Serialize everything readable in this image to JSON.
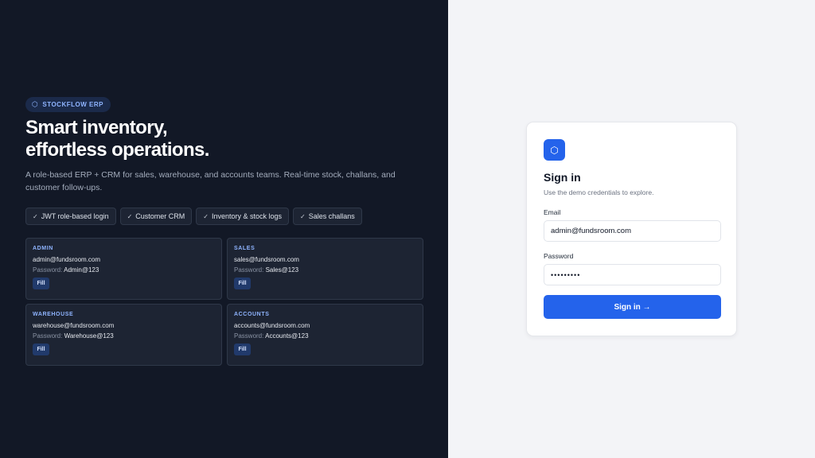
{
  "brand": {
    "icon": "hexagon-icon",
    "label": "STOCKFLOW ERP"
  },
  "hero": {
    "headline_line1": "Smart inventory,",
    "headline_line2": "effortless operations.",
    "description": "A role-based ERP + CRM for sales, warehouse, and accounts teams. Real-time stock, challans, and customer follow-ups."
  },
  "features": [
    {
      "icon": "check-icon",
      "label": "JWT role-based login"
    },
    {
      "icon": "check-icon",
      "label": "Customer CRM"
    },
    {
      "icon": "check-icon",
      "label": "Inventory & stock logs"
    },
    {
      "icon": "check-icon",
      "label": "Sales challans"
    }
  ],
  "password_label": "Password:",
  "fill_label": "Fill",
  "demo_accounts": [
    {
      "role": "ADMIN",
      "email": "admin@fundsroom.com",
      "password": "Admin@123"
    },
    {
      "role": "SALES",
      "email": "sales@fundsroom.com",
      "password": "Sales@123"
    },
    {
      "role": "WAREHOUSE",
      "email": "warehouse@fundsroom.com",
      "password": "Warehouse@123"
    },
    {
      "role": "ACCOUNTS",
      "email": "accounts@fundsroom.com",
      "password": "Accounts@123"
    }
  ],
  "login": {
    "logo_icon": "hexagon-icon",
    "title": "Sign in",
    "subtitle": "Use the demo credentials to explore.",
    "email_label": "Email",
    "email_value": "admin@fundsroom.com",
    "password_label": "Password",
    "password_value": "•••••••••",
    "submit_label": "Sign in →"
  },
  "colors": {
    "left_bg": "#121826",
    "accent": "#2463eb",
    "role_label": "#8fb4ff",
    "right_bg": "#f3f4f7"
  }
}
